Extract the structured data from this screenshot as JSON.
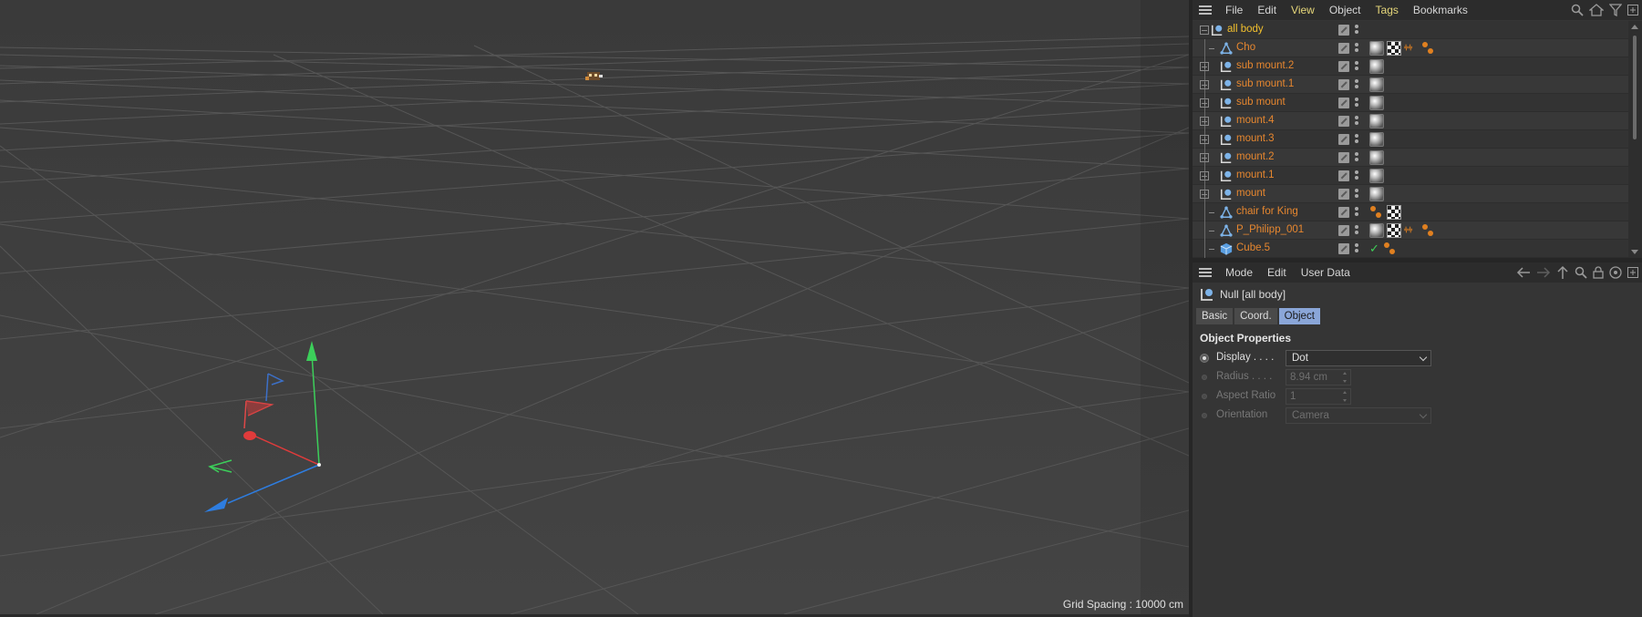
{
  "viewport": {
    "grid_spacing_label": "Grid Spacing : 10000 cm",
    "axis_colors": {
      "x": "#e03b3b",
      "y": "#3ccf5a",
      "z": "#2e7de0"
    }
  },
  "object_manager": {
    "menu": [
      "File",
      "Edit",
      "View",
      "Object",
      "Tags",
      "Bookmarks"
    ],
    "menu_highlight": [
      "View",
      "Tags"
    ],
    "toolbar_icons": [
      "search-icon",
      "home-icon",
      "filter-icon",
      "new-panel-icon"
    ],
    "objects": [
      {
        "name": "all body",
        "type": "null",
        "expand": "minus",
        "level": 0,
        "tags": []
      },
      {
        "name": "Cho",
        "type": "polygon",
        "expand": "none",
        "level": 1,
        "tags": [
          "material",
          "checker",
          "ik",
          "bones"
        ]
      },
      {
        "name": "sub mount.2",
        "type": "null",
        "expand": "plus",
        "level": 1,
        "tags": [
          "material"
        ]
      },
      {
        "name": "sub mount.1",
        "type": "null",
        "expand": "plus",
        "level": 1,
        "tags": [
          "material"
        ]
      },
      {
        "name": "sub mount",
        "type": "null",
        "expand": "plus",
        "level": 1,
        "tags": [
          "material"
        ]
      },
      {
        "name": "mount.4",
        "type": "null",
        "expand": "plus",
        "level": 1,
        "tags": [
          "material"
        ]
      },
      {
        "name": "mount.3",
        "type": "null",
        "expand": "plus",
        "level": 1,
        "tags": [
          "material"
        ]
      },
      {
        "name": "mount.2",
        "type": "null",
        "expand": "plus",
        "level": 1,
        "tags": [
          "material"
        ]
      },
      {
        "name": "mount.1",
        "type": "null",
        "expand": "plus",
        "level": 1,
        "tags": [
          "material"
        ]
      },
      {
        "name": "mount",
        "type": "null",
        "expand": "plus",
        "level": 1,
        "tags": [
          "material"
        ]
      },
      {
        "name": "chair for King",
        "type": "polygon",
        "expand": "none",
        "level": 1,
        "tags": [
          "bones",
          "checker"
        ]
      },
      {
        "name": "P_Philipp_001",
        "type": "polygon",
        "expand": "none",
        "level": 1,
        "tags": [
          "material",
          "checker",
          "ik",
          "bones"
        ]
      },
      {
        "name": "Cube.5",
        "type": "cube",
        "expand": "none",
        "level": 1,
        "tags": [
          "ok",
          "bones"
        ]
      }
    ]
  },
  "attribute_manager": {
    "menu": [
      "Mode",
      "Edit",
      "User Data"
    ],
    "toolbar_icons": [
      "back-icon",
      "forward-icon",
      "up-icon",
      "search-icon",
      "lock-icon",
      "target-icon",
      "new-panel-icon"
    ],
    "object_title": "Null [all body]",
    "tabs": [
      "Basic",
      "Coord.",
      "Object"
    ],
    "active_tab": "Object",
    "section_title": "Object Properties",
    "properties": {
      "display": {
        "label": "Display . . . .",
        "value": "Dot"
      },
      "radius": {
        "label": "Radius . . . .",
        "value": "8.94 cm"
      },
      "aspect_ratio": {
        "label": "Aspect Ratio",
        "value": "1"
      },
      "orientation": {
        "label": "Orientation",
        "value": "Camera"
      }
    }
  }
}
